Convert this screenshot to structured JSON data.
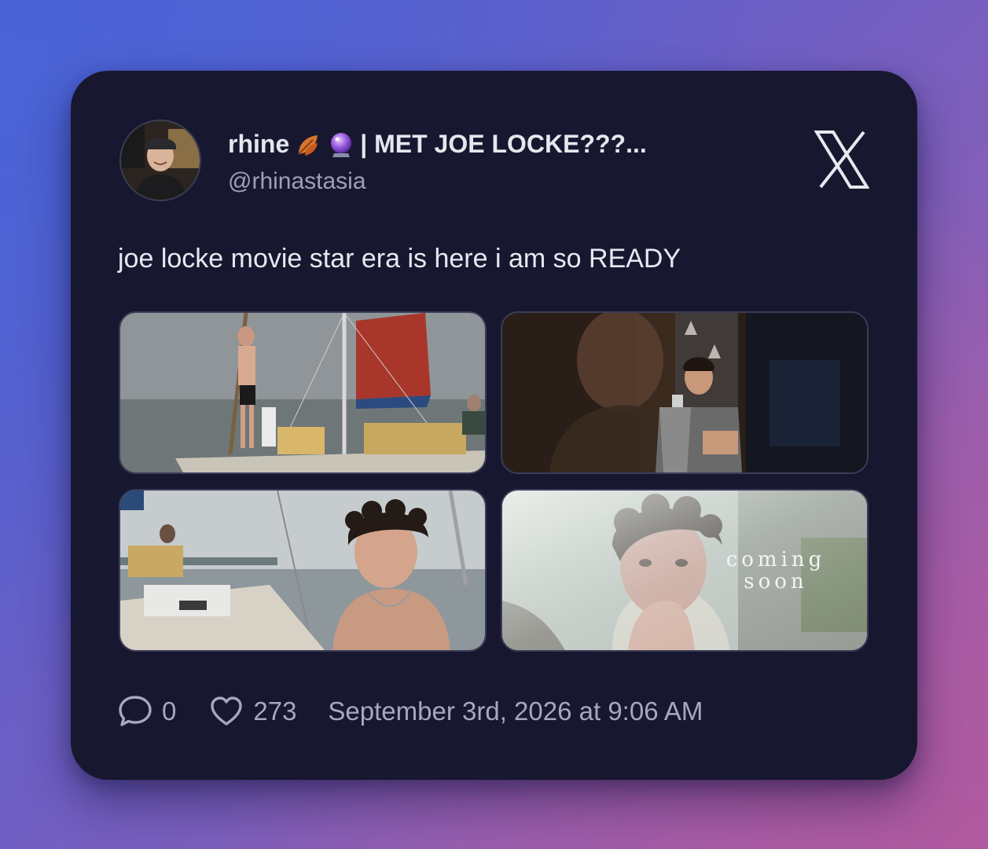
{
  "author": {
    "display_name": "rhine",
    "display_name_suffix": "| MET JOE LOCKE???...",
    "emojis": [
      "fallen-leaf-icon",
      "crystal-ball-icon"
    ],
    "handle": "@rhinastasia"
  },
  "platform": {
    "logo": "x-logo-icon"
  },
  "tweet": {
    "text": "joe locke movie star era is here i am so READY"
  },
  "media": [
    {
      "subject": "sailboat-scene"
    },
    {
      "subject": "phone-scene"
    },
    {
      "subject": "boat-closeup-scene"
    },
    {
      "subject": "car-closeup-scene",
      "overlay_line1": "coming",
      "overlay_line2": "soon"
    }
  ],
  "footer": {
    "reply_icon": "comment-icon",
    "reply_count": "0",
    "like_icon": "heart-icon",
    "like_count": "273",
    "timestamp": "September 3rd, 2026 at 9:06 AM"
  },
  "colors": {
    "card_bg": "#171830",
    "text_primary": "#e6e6ee",
    "text_secondary": "#9ea0b5"
  }
}
